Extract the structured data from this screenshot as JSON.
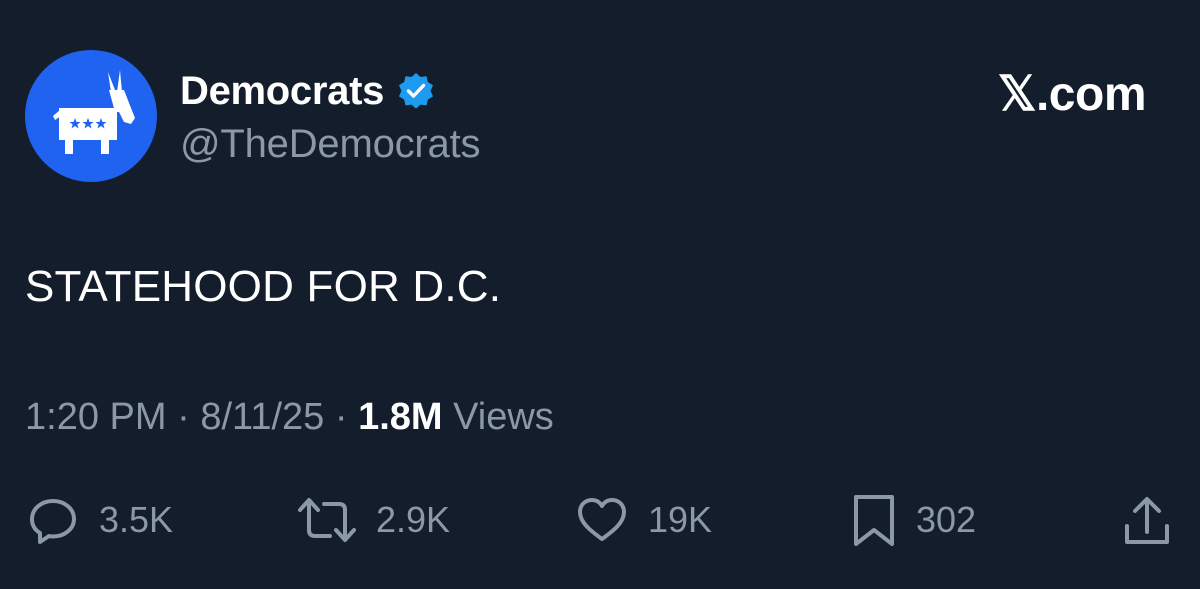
{
  "author": {
    "display_name": "Democrats",
    "handle": "@TheDemocrats",
    "verified": true,
    "avatar_icon": "democratic-donkey-icon"
  },
  "brand": {
    "label": "𝕏.com"
  },
  "tweet": {
    "text": "STATEHOOD FOR D.C.",
    "time": "1:20 PM",
    "separator": "·",
    "date": "8/11/25",
    "views_count": "1.8M",
    "views_label": "Views"
  },
  "actions": {
    "replies": "3.5K",
    "reposts": "2.9K",
    "likes": "19K",
    "bookmarks": "302"
  },
  "colors": {
    "background": "#141d2b",
    "avatar_blue": "#1f63f0",
    "verified_blue": "#1d9bf0",
    "secondary_text": "#8b98a5"
  }
}
